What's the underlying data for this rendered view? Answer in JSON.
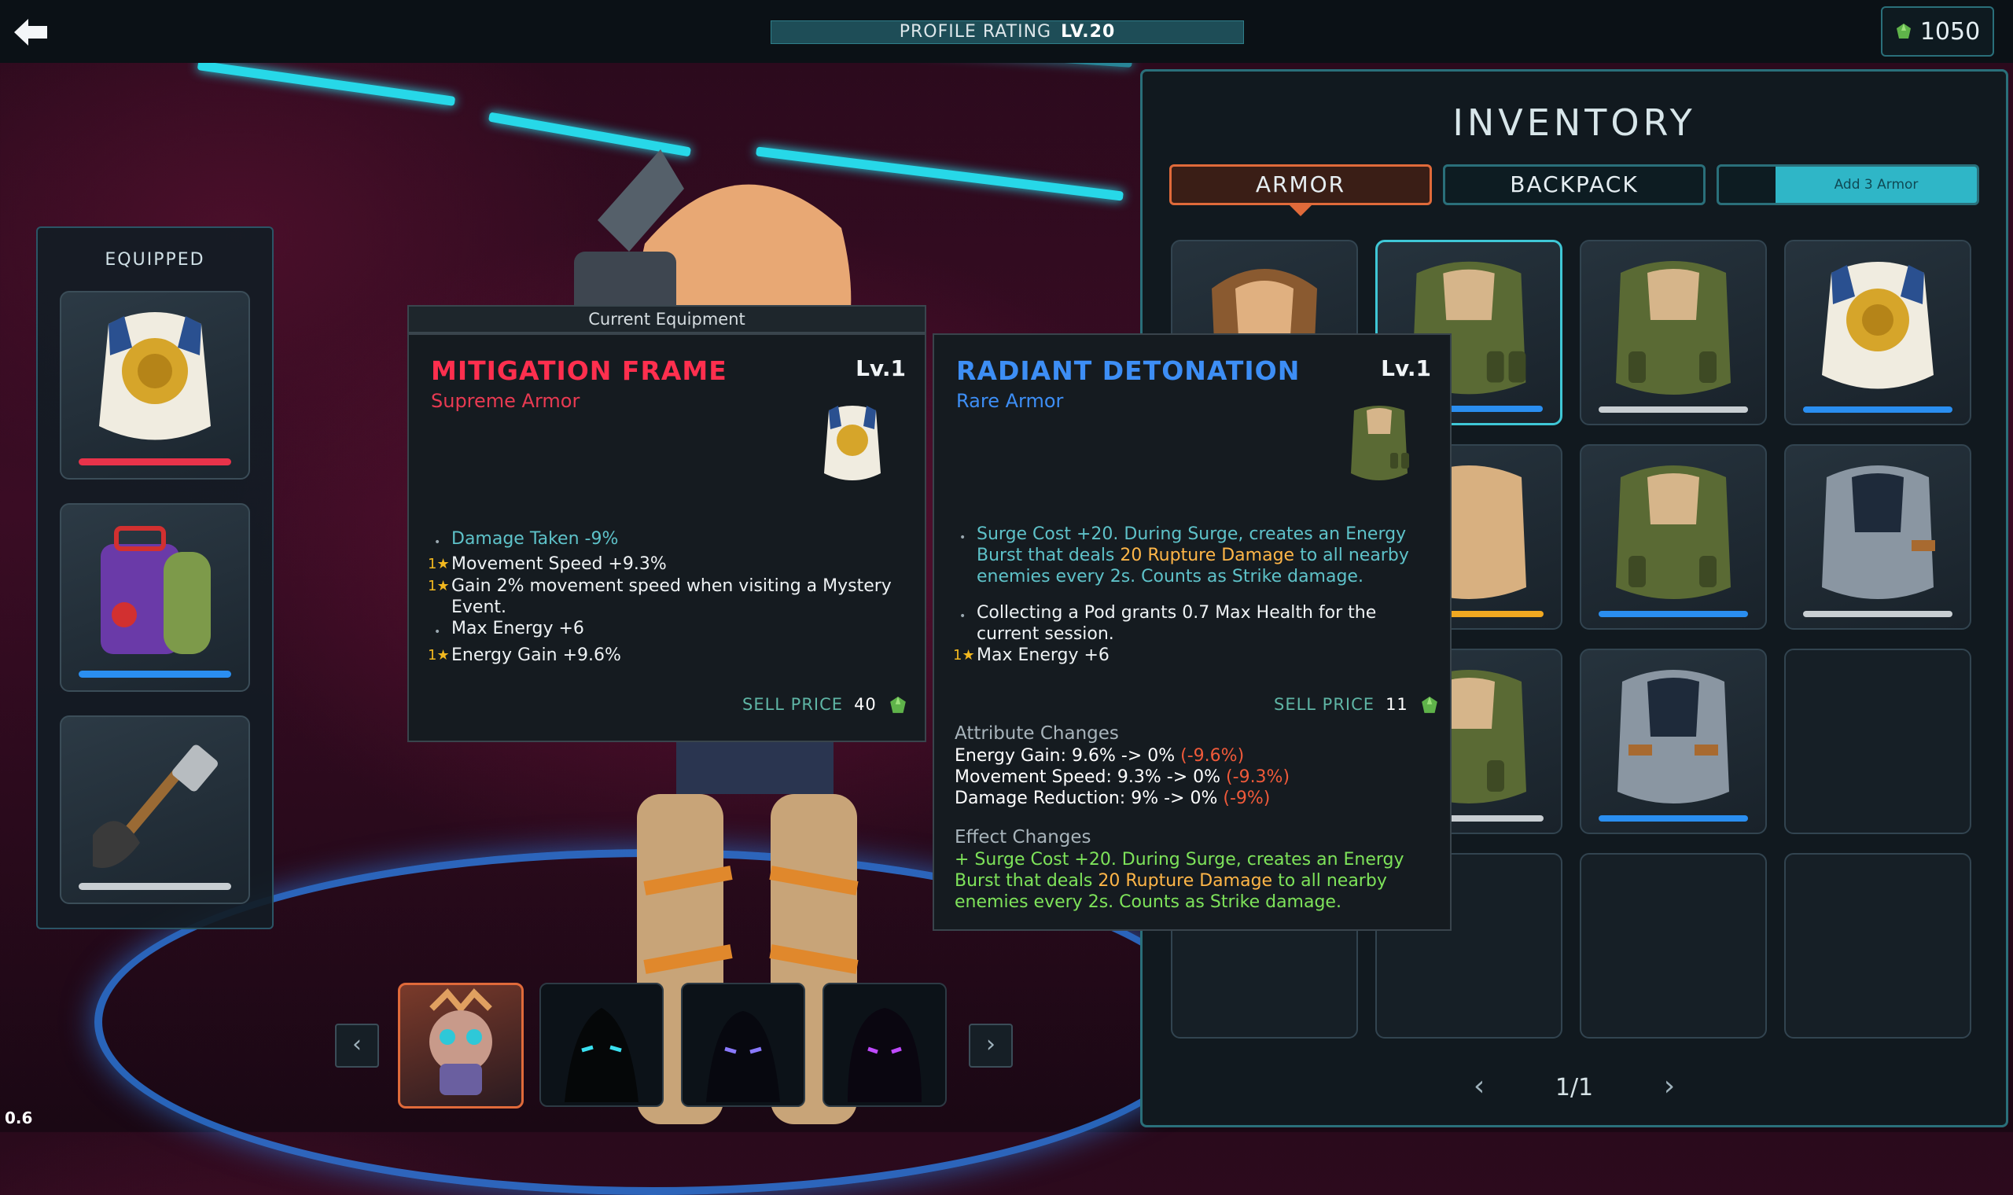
{
  "topbar": {
    "profile_label": "PROFILE RATING",
    "profile_level": "LV.20",
    "currency": "1050"
  },
  "version": "0.6",
  "equipped": {
    "title": "EQUIPPED",
    "slots": [
      {
        "name": "golden lion armor",
        "rarity_color": "#e8334a"
      },
      {
        "name": "purple backpack",
        "rarity_color": "#2a8ef0"
      },
      {
        "name": "axe weapon",
        "rarity_color": "#c8ced2"
      }
    ]
  },
  "inventory": {
    "title": "INVENTORY",
    "tabs": {
      "armor": "ARMOR",
      "backpack": "BACKPACK",
      "add": "Add 3 Armor"
    },
    "pager": {
      "label": "1/1"
    },
    "slots": [
      {
        "item": "hooded scarf armor",
        "bar": null
      },
      {
        "item": "green tactical vest",
        "bar": "#2a8ef0",
        "selected": true
      },
      {
        "item": "green tactical vest",
        "bar": "#c8ced2"
      },
      {
        "item": "golden lion armor",
        "bar": "#2a8ef0"
      },
      {
        "item": "tan vest",
        "bar": "#f0a821"
      },
      {
        "item": "green tactical vest",
        "bar": "#2a8ef0"
      },
      {
        "item": "steel plate armor",
        "bar": "#c8ced2"
      },
      {
        "item": "green tactical vest",
        "bar": "#c8ced2"
      },
      {
        "item": "steel plate armor",
        "bar": "#2a8ef0"
      }
    ]
  },
  "tooltip_current": {
    "header": "Current Equipment",
    "name": "MITIGATION FRAME",
    "rarity": "Supreme Armor",
    "level": "Lv.1",
    "name_color": "#ff2f4e",
    "attributes": [
      {
        "marker": "•",
        "text": "Damage Taken -9%",
        "highlight": true
      },
      {
        "marker": "1★",
        "text": "Movement Speed +9.3%"
      },
      {
        "marker": "1★",
        "text": "Gain 2% movement speed when visiting a Mystery Event."
      },
      {
        "marker": "•",
        "text": "Max Energy +6"
      },
      {
        "marker": "1★",
        "text": "Energy Gain +9.6%"
      }
    ],
    "sell_label": "SELL PRICE",
    "sell_value": "40"
  },
  "tooltip_new": {
    "name": "RADIANT DETONATION",
    "rarity": "Rare Armor",
    "level": "Lv.1",
    "name_color": "#3d8ef5",
    "attr1_a": "Surge Cost +20. During Surge, creates an Energy Burst that deals ",
    "attr1_b": "20 Rupture Damage",
    "attr1_c": " to all nearby enemies every 2s. Counts as Strike damage.",
    "attr2": "Collecting a Pod grants 0.7 Max Health for the current session.",
    "attr3_marker": "1★",
    "attr3": "Max Energy +6",
    "sell_label": "SELL PRICE",
    "sell_value": "11",
    "attribute_changes_title": "Attribute Changes",
    "changes": [
      {
        "text": "Energy Gain: 9.6% -> 0%",
        "delta": "(-9.6%)"
      },
      {
        "text": "Movement Speed: 9.3% -> 0%",
        "delta": "(-9.3%)"
      },
      {
        "text": "Damage Reduction: 9% -> 0%",
        "delta": "(-9%)"
      }
    ],
    "effect_changes_title": "Effect Changes",
    "effect_a": "+ Surge Cost +20. During Surge, creates an Energy Burst that deals ",
    "effect_b": "20 Rupture Damage",
    "effect_c": " to all nearby enemies every 2s. Counts as Strike damage."
  },
  "characters": [
    {
      "name": "masked warrior portrait",
      "selected": true
    },
    {
      "name": "locked shadow cyan-eyes"
    },
    {
      "name": "locked shadow blue-eyes"
    },
    {
      "name": "locked shadow purple-eyes"
    }
  ]
}
